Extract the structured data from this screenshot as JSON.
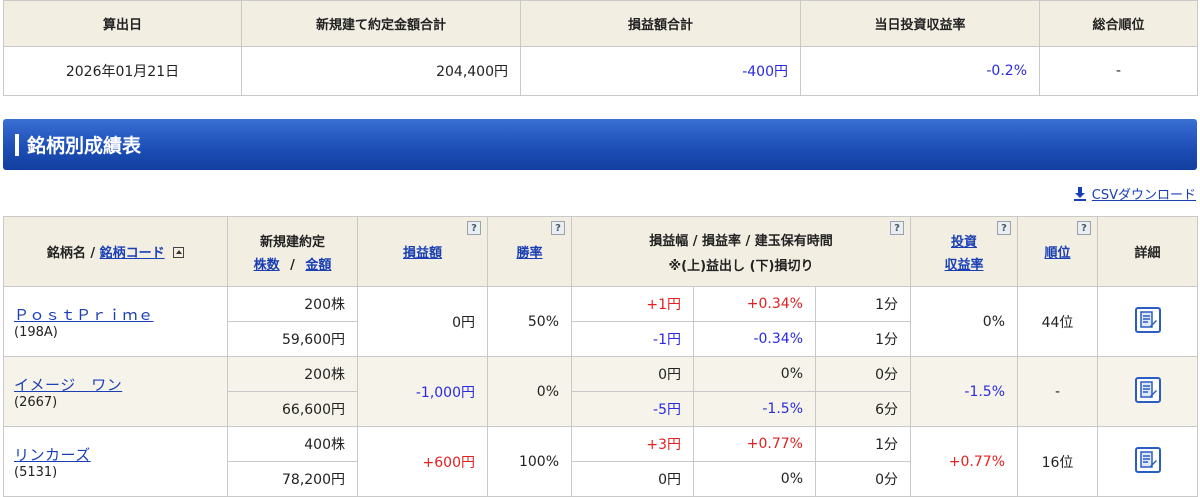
{
  "summary": {
    "headers": [
      "算出日",
      "新規建て約定金額合計",
      "損益額合計",
      "当日投資収益率",
      "総合順位"
    ],
    "date": "2026年01月21日",
    "contract_total": "204,400円",
    "pnl_total": "-400円",
    "return_rate": "-0.2%",
    "rank": "-"
  },
  "section": {
    "title": "銘柄別成績表"
  },
  "csv_label": "CSVダウンロード",
  "table": {
    "h_name": "銘柄名 /",
    "h_code": "銘柄コード",
    "h_contract": "新規建約定",
    "h_shares": "株数",
    "h_sep": "/",
    "h_amount": "金額",
    "h_pnl": "損益額",
    "h_winrate": "勝率",
    "h_range1": "損益幅 / 損益率 / 建玉保有時間",
    "h_range2": "※(上)益出し (下)損切り",
    "h_return1": "投資",
    "h_return2": "収益率",
    "h_rank": "順位",
    "h_detail": "詳細",
    "help": "?",
    "rows": [
      {
        "name": "ＰｏｓｔＰｒｉｍｅ",
        "code": "(198A)",
        "shares": "200株",
        "amount": "59,600円",
        "pnl": "0円",
        "winrate": "50%",
        "up_range": "+1円",
        "up_rate": "+0.34%",
        "up_time": "1分",
        "down_range": "-1円",
        "down_rate": "-0.34%",
        "down_time": "1分",
        "return": "0%",
        "rank": "44位"
      },
      {
        "name": "イメージ　ワン",
        "code": "(2667)",
        "shares": "200株",
        "amount": "66,600円",
        "pnl": "-1,000円",
        "winrate": "0%",
        "up_range": "0円",
        "up_rate": "0%",
        "up_time": "0分",
        "down_range": "-5円",
        "down_rate": "-1.5%",
        "down_time": "6分",
        "return": "-1.5%",
        "rank": "-"
      },
      {
        "name": "リンカーズ",
        "code": "(5131)",
        "shares": "400株",
        "amount": "78,200円",
        "pnl": "+600円",
        "winrate": "100%",
        "up_range": "+3円",
        "up_rate": "+0.77%",
        "up_time": "1分",
        "down_range": "0円",
        "down_rate": "0%",
        "down_time": "0分",
        "return": "+0.77%",
        "rank": "16位"
      }
    ]
  },
  "colors": {
    "header_bg": "#f2efe2",
    "section_blue": "#1d4fb8",
    "positive": "#e22020",
    "negative": "#2a2adf",
    "link": "#1a3fb4"
  },
  "icons": {
    "download": "download-icon",
    "help": "help-icon",
    "sort": "sort-icon",
    "detail": "detail-memo-icon"
  }
}
